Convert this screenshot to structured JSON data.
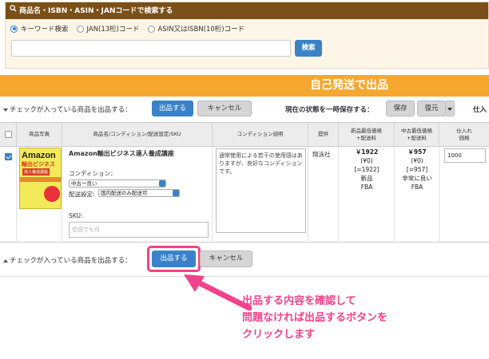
{
  "search": {
    "header": "商品名・ISBN・ASIN・JANコードで検索する",
    "options": [
      "キーワード検索",
      "JAN(13桁)コード",
      "ASIN又はISBN(10桁)コード"
    ],
    "selected_option": "キーワード検索",
    "input_value": "",
    "button_label": "検索"
  },
  "banner": {
    "title": "自己発送で出品"
  },
  "action_bar": {
    "label": "チェックが入っている商品を出品する：",
    "submit_label": "出品する",
    "cancel_label": "キャンセル",
    "save_state_label": "現在の状態を一時保存する：",
    "save_label": "保存",
    "restore_label": "復元",
    "truncated_label": "仕入"
  },
  "table": {
    "headers": [
      "商品写真",
      "商品名/コンディション/配送設定/SKU",
      "コンディション説明",
      "提供",
      "新品最低価格\n+配送料",
      "中古最低価格\n+配送料",
      "仕入れ\n価格"
    ],
    "row": {
      "checked": true,
      "title": "Amazon輸出ビジネス達人養成講座",
      "condition_label": "コンディション：",
      "condition_value": "中古ー良い",
      "shipping_label": "配送設定:",
      "shipping_value": "国内配送のみ配送可",
      "sku_label": "SKU:",
      "sku_placeholder": "空白でも可",
      "condition_note": "通常使用による若干の使用感はありますが、良好なコンディションです。",
      "provider": "翔泳社",
      "new_price": "￥1922",
      "new_ship": "(¥0)",
      "new_total": "[=1922]",
      "new_cond": "新品",
      "new_channel": "FBA",
      "used_price": "￥957",
      "used_ship": "(¥0)",
      "used_total": "[=957]",
      "used_cond": "非常に良い",
      "used_channel": "FBA",
      "cost_value": "1000"
    },
    "book": {
      "title_line1": "Amazon",
      "title_line2": "輸出ビジネス",
      "title_line3": "達人養成講座"
    }
  },
  "bottom_bar": {
    "label": "チェックが入っている商品を出品する：",
    "submit_label": "出品する",
    "cancel_label": "キャンセル"
  },
  "annotation": {
    "lines": [
      "出品する内容を確認して",
      "問題なければ出品するボタンを",
      "クリックします"
    ],
    "color": "#f2428b"
  },
  "colors": {
    "brown": "#7a4f18",
    "orange": "#f6a72f",
    "blue": "#3a82c8",
    "pink": "#f2428b"
  }
}
